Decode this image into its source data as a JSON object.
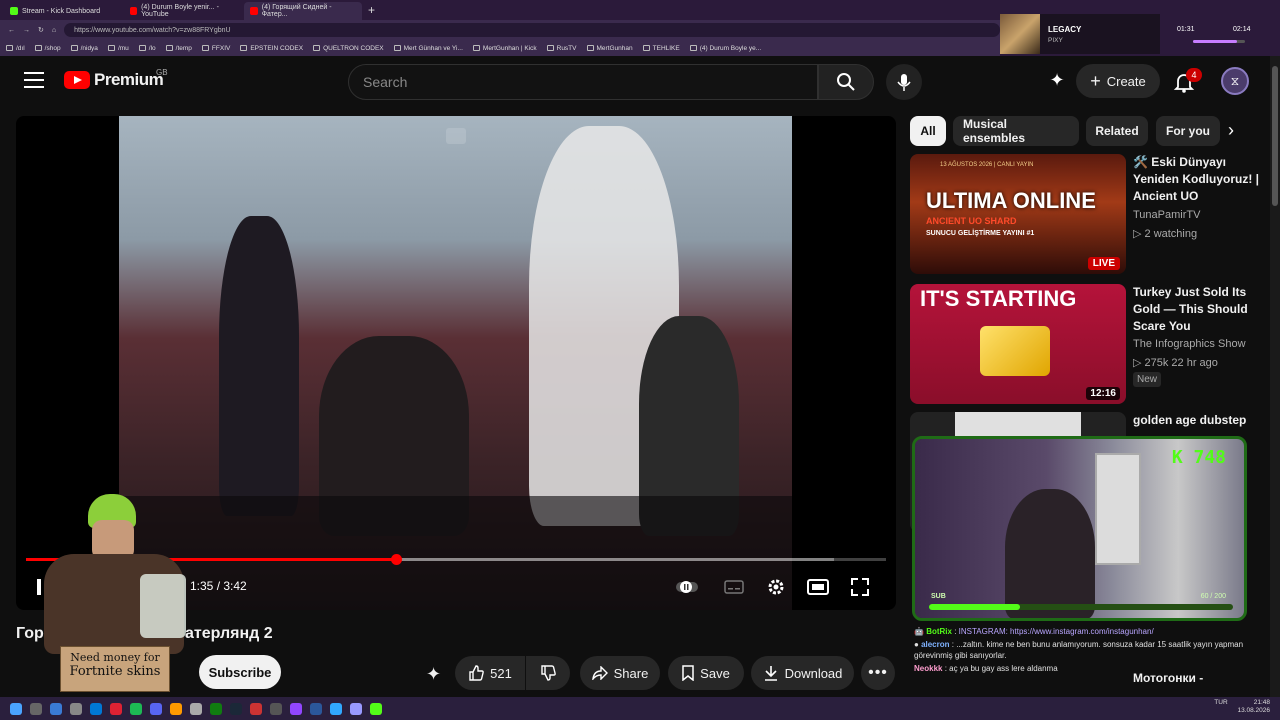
{
  "browser": {
    "tabs": [
      {
        "label": "Stream - Kick Dashboard",
        "color": "#53fc18"
      },
      {
        "label": "(4) Durum Boyle yenir... - YouTube",
        "color": "#ff0000"
      },
      {
        "label": "(4) Горящий Сидней - Фатер...",
        "color": "#ff0000"
      }
    ],
    "new_tab": "+",
    "url": "https://www.youtube.com/watch?v=zw88FRYgbnU",
    "bookmarks": [
      "/dıl",
      "/shop",
      "/nidya",
      "/mu",
      "/lo",
      "/temp",
      "FFXIV",
      "EPSTEIN CODEX",
      "QUELTRON CODEX",
      "Mert Günhan ve Yi...",
      "MertGunhan | Kick",
      "RusTV",
      "MertGunhan",
      "TEHLIKE",
      "(4) Durum Boyle ye..."
    ]
  },
  "music": {
    "title": "LEGACY",
    "artist": "PIXY",
    "elapsed": "01:31",
    "total": "02:14",
    "progress": 0.85
  },
  "header": {
    "logo_text": "Premium",
    "region": "GB",
    "search_placeholder": "Search",
    "create_label": "Create",
    "notification_count": "4"
  },
  "player": {
    "current_time": "1:35",
    "duration": "3:42",
    "time_display": "1:35 / 3:42",
    "played_fraction": 0.43,
    "buffered_fraction": 0.94
  },
  "video": {
    "title_visible_left": "Гор",
    "title_visible_right": "атерлянд 2",
    "subscribe_label": "Subscribe",
    "like_count": "521",
    "share_label": "Share",
    "save_label": "Save",
    "download_label": "Download"
  },
  "chips": [
    "All",
    "Musical ensembles",
    "Related",
    "For you"
  ],
  "recommendations": [
    {
      "title": "🛠️ Eski Dünyayı Yeniden Kodluyoruz! | Ancient UO Geliştirm...",
      "channel": "TunaPamirTV",
      "meta": "2 watching",
      "badge": "LIVE",
      "thumb_text": "ULTIMA ONLINE",
      "thumb_sub": "ANCIENT UO SHARD",
      "thumb_sub2": "SUNUCU GELİŞTİRME YAYINI #1",
      "thumb_date": "13 AĞUSTOS 2026 | CANLI YAYIN"
    },
    {
      "title": "Turkey Just Sold Its Gold — This Should Scare You",
      "channel": "The Infographics Show",
      "meta": "275k  22 hr ago",
      "badge": "New",
      "duration": "12:16",
      "thumb_text": "IT'S STARTING"
    },
    {
      "title": "golden age dubstep",
      "channel": "",
      "meta": ""
    },
    {
      "title": "Мотогонки -",
      "channel": "",
      "meta": ""
    }
  ],
  "webcam": {
    "kick_count": "K 748",
    "sub_label": "SUB",
    "sub_progress": "60 / 200",
    "sub_fraction": 0.3
  },
  "chat": [
    {
      "user": "BotRix",
      "sep": " : ",
      "text": "INSTAGRAM: https://www.instagram.com/instagunhan/"
    },
    {
      "user": "alecron",
      "sep": " : ",
      "text": "...zaltın. kime ne ben bunu anlamıyorum. sonsuza kadar 15 saatlik yayın yapman görevinmiş gibi sanıyorlar."
    },
    {
      "user": "Neokkk",
      "sep": " : ",
      "text": "aç ya bu gay ass lere aldanma"
    }
  ],
  "streamer_sign": {
    "line1": "Need money for",
    "line2": "Fortnite skins"
  },
  "taskbar": {
    "lang": "TUR",
    "time": "21:48",
    "date": "13.08.2026"
  },
  "colors": {
    "youtube_red": "#ff0000",
    "kick_green": "#53fc18",
    "bg": "#0f0f0f"
  }
}
